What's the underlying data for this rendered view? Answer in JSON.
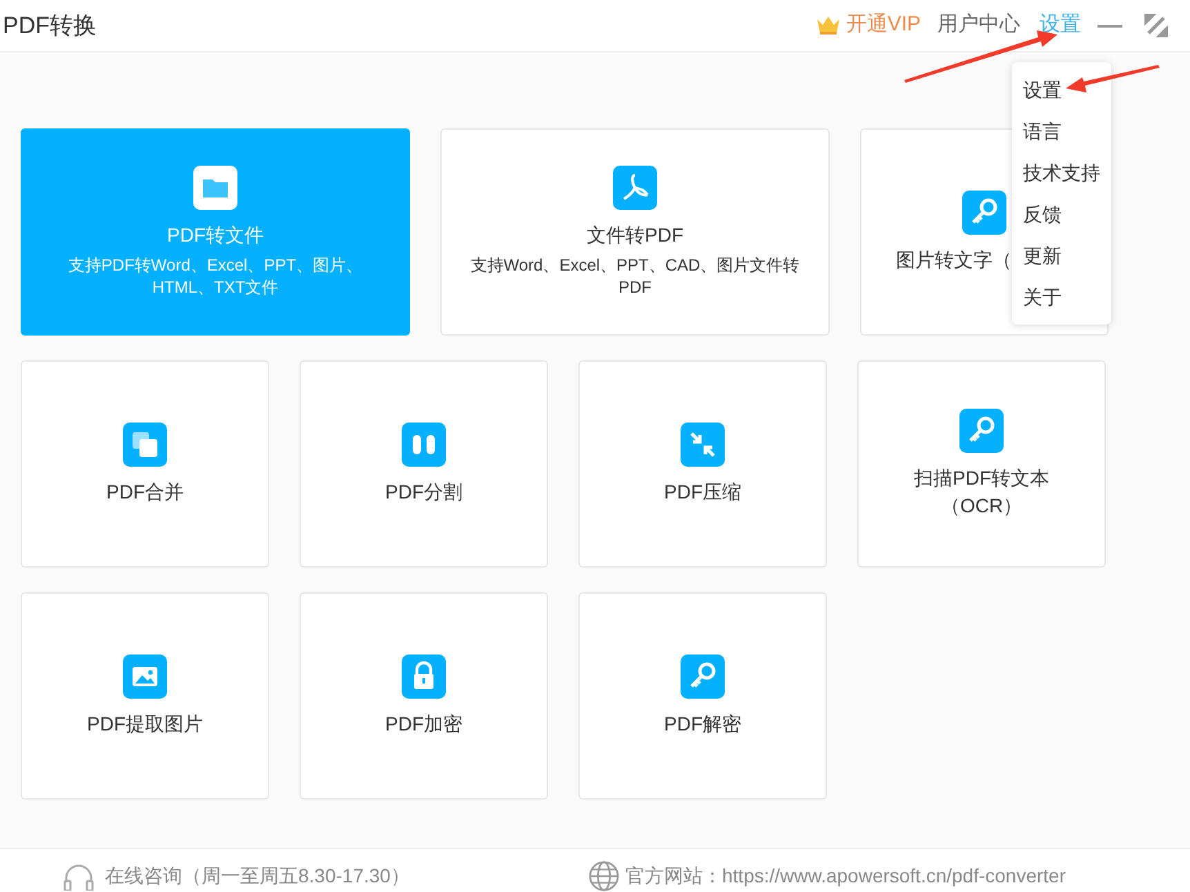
{
  "window": {
    "title": "PDF转换"
  },
  "header": {
    "vip": "开通VIP",
    "user_center": "用户中心",
    "settings": "设置"
  },
  "settings_menu": [
    "设置",
    "语言",
    "技术支持",
    "反馈",
    "更新",
    "关于"
  ],
  "rows": [
    [
      {
        "kind": "wide",
        "selected": true,
        "title": "PDF转文件",
        "desc": "支持PDF转Word、Excel、PPT、图片、HTML、TXT文件"
      },
      {
        "kind": "wide",
        "selected": false,
        "title": "文件转PDF",
        "desc": "支持Word、Excel、PPT、CAD、图片文件转PDF"
      },
      {
        "kind": "cut",
        "selected": false,
        "title": "图片转文字（"
      }
    ],
    [
      {
        "kind": "tile",
        "selected": false,
        "title": "PDF合并"
      },
      {
        "kind": "tile",
        "selected": false,
        "title": "PDF分割"
      },
      {
        "kind": "tile",
        "selected": false,
        "title": "PDF压缩"
      },
      {
        "kind": "tile",
        "selected": false,
        "title": "扫描PDF转文本（OCR）"
      }
    ],
    [
      {
        "kind": "tile",
        "selected": false,
        "title": "PDF提取图片"
      },
      {
        "kind": "tile",
        "selected": false,
        "title": "PDF加密"
      },
      {
        "kind": "tile",
        "selected": false,
        "title": "PDF解密"
      }
    ]
  ],
  "footer": {
    "support": "在线咨询（周一至周五8.30-17.30）",
    "website": "官方网站：https://www.apowersoft.cn/pdf-converter"
  }
}
